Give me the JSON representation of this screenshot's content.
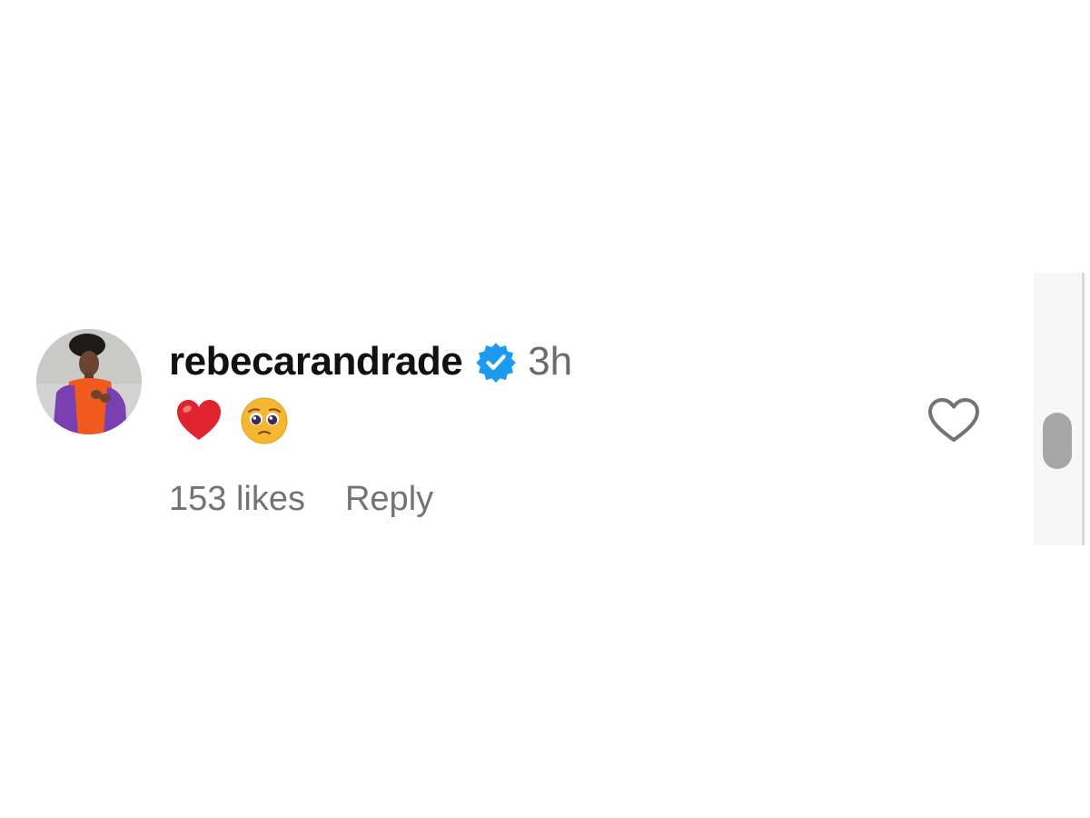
{
  "comment": {
    "username": "rebecarandrade",
    "verified_icon": "verified-badge-icon",
    "timestamp": "3h",
    "reactions": [
      "heart-emoji",
      "pleading-face-emoji"
    ],
    "likes": "153 likes",
    "reply_label": "Reply",
    "like_icon": "heart-outline-icon"
  },
  "colors": {
    "username": "#111111",
    "meta_text": "#737373",
    "verified": "#1d9bf0",
    "heart_emoji": "#e0242f",
    "pleading_emoji": "#f5b731"
  }
}
